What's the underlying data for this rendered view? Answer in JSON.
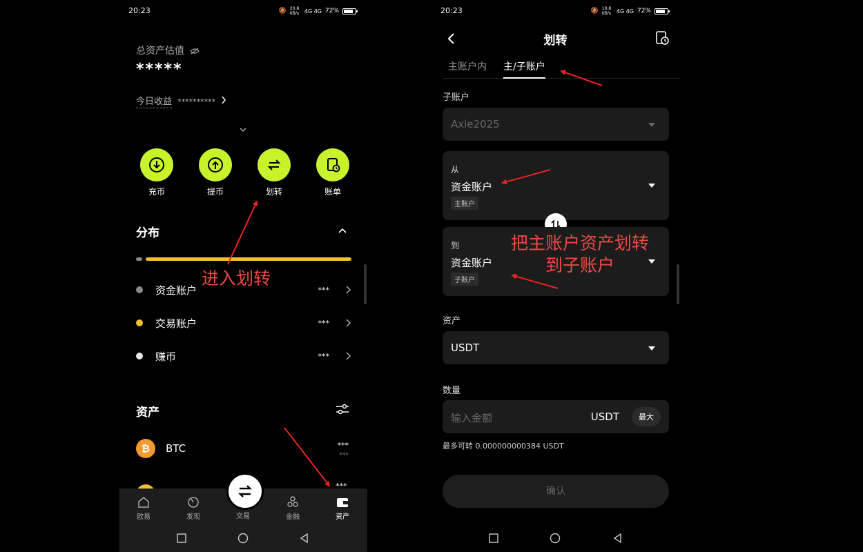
{
  "left": {
    "status": {
      "time": "20:23",
      "net_speed": "20.8 KB/s",
      "signal": "4G 4G",
      "battery": "72%"
    },
    "total_asset_label": "总资产估值",
    "total_asset_value": "*****",
    "today_label": "今日收益",
    "today_value": "**********",
    "actions": [
      {
        "label": "充币",
        "icon": "deposit-icon"
      },
      {
        "label": "提币",
        "icon": "withdraw-icon"
      },
      {
        "label": "划转",
        "icon": "transfer-icon"
      },
      {
        "label": "账单",
        "icon": "bill-icon"
      }
    ],
    "distribution_title": "分布",
    "distribution_items": [
      {
        "name": "资金账户",
        "value": "***",
        "color": "#8a8a8a"
      },
      {
        "name": "交易账户",
        "value": "***",
        "color": "#f5c030"
      },
      {
        "name": "赚币",
        "value": "***",
        "color": "#e6e6e6"
      }
    ],
    "assets_title": "资产",
    "assets": [
      {
        "symbol": "BTC",
        "value": "***",
        "sub_value": "***"
      }
    ],
    "next_asset_value": "***",
    "nav": [
      {
        "label": "欧易",
        "icon": "home-icon"
      },
      {
        "label": "发现",
        "icon": "discover-icon"
      },
      {
        "label": "交易",
        "icon": "trade-icon"
      },
      {
        "label": "金融",
        "icon": "finance-icon"
      },
      {
        "label": "资产",
        "icon": "wallet-icon",
        "active": true
      }
    ],
    "annotation": "进入划转"
  },
  "right": {
    "status": {
      "time": "20:23",
      "net_speed": "10.8 KB/s",
      "signal": "4G 4G",
      "battery": "72%"
    },
    "title": "划转",
    "tabs": [
      {
        "label": "主账户内"
      },
      {
        "label": "主/子账户",
        "active": true
      }
    ],
    "sub_account_label": "子账户",
    "sub_account_value": "Axie2025",
    "from_label": "从",
    "from_account": "资金账户",
    "from_tag": "主账户",
    "to_label": "到",
    "to_account": "资金账户",
    "to_tag": "子账户",
    "asset_label": "资产",
    "asset_value": "USDT",
    "amount_label": "数量",
    "amount_placeholder": "输入金额",
    "amount_unit": "USDT",
    "max_label": "最大",
    "max_transferable": "最多可转 0.000000000384 USDT",
    "confirm_label": "确认",
    "annotation_line1": "把主账户资产划转",
    "annotation_line2": "到子账户"
  },
  "colors": {
    "accent": "#c8f32b",
    "annotation": "#e8261e"
  }
}
